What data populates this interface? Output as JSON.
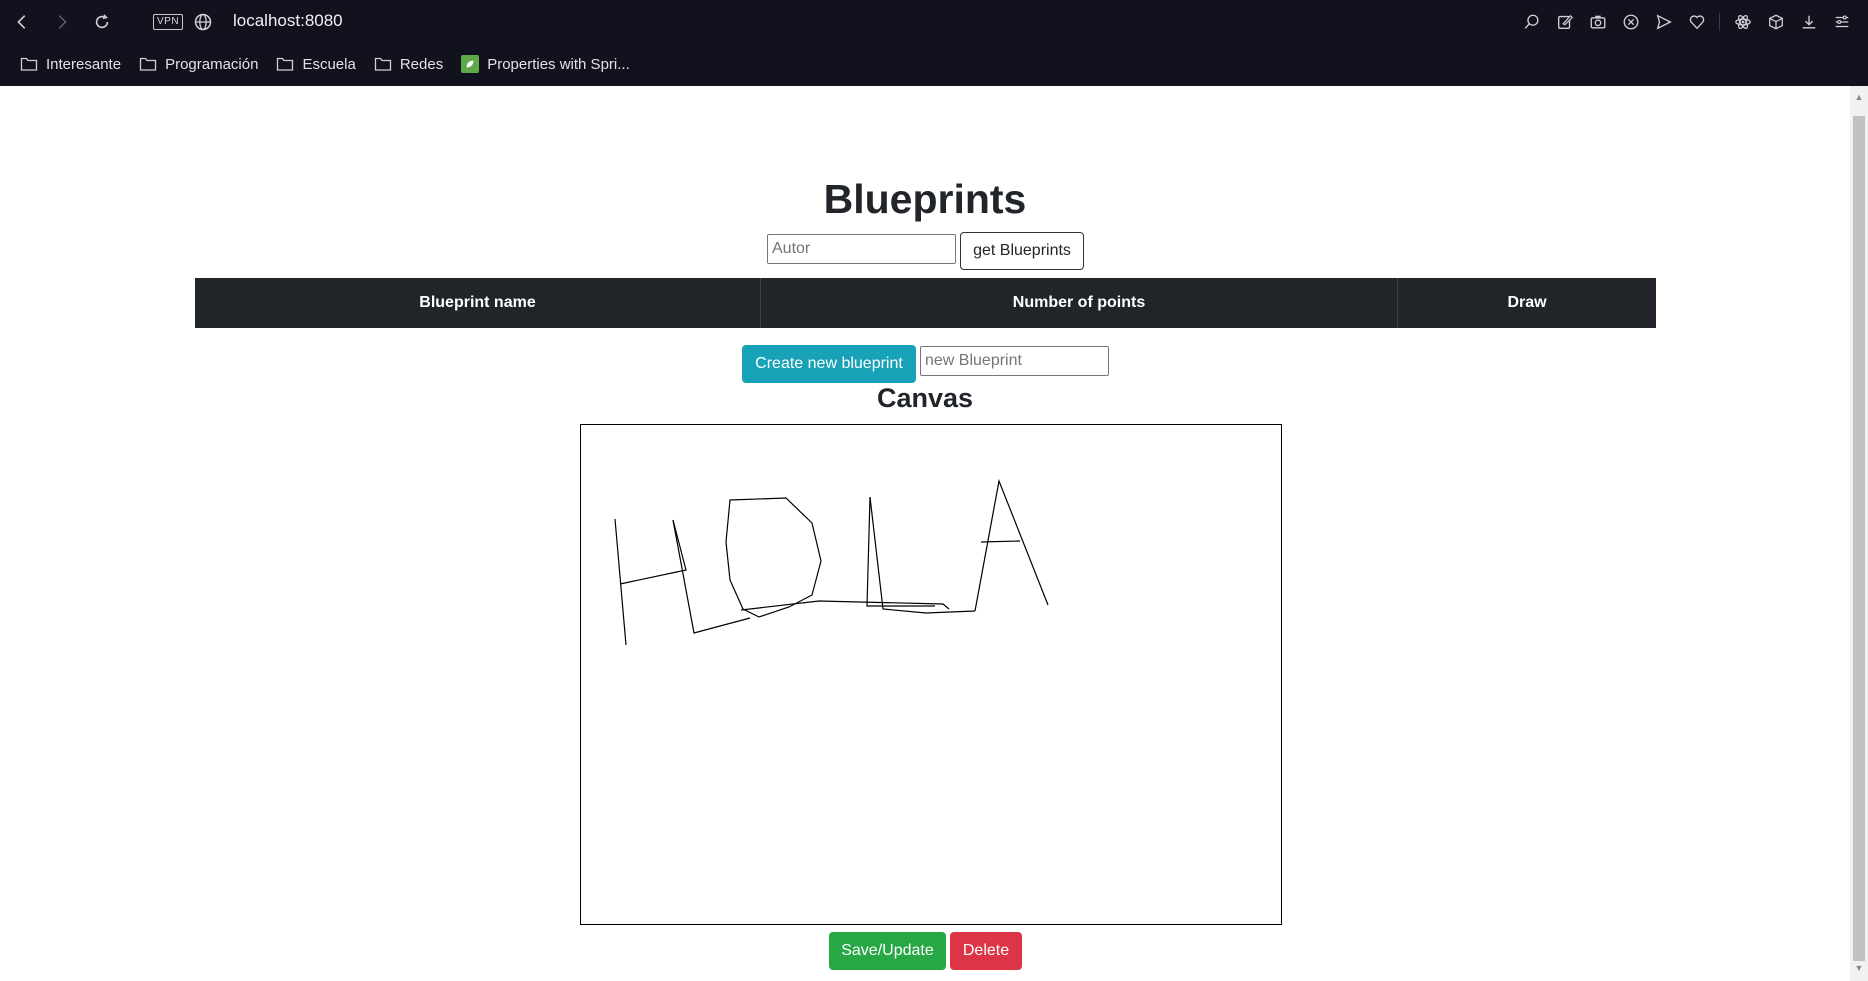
{
  "browser": {
    "vpn_label": "VPN",
    "url": "localhost:8080",
    "bookmarks": [
      {
        "label": "Interesante",
        "icon": "folder-icon"
      },
      {
        "label": "Programación",
        "icon": "folder-icon"
      },
      {
        "label": "Escuela",
        "icon": "folder-icon"
      },
      {
        "label": "Redes",
        "icon": "folder-icon"
      },
      {
        "label": "Properties with Spri...",
        "icon": "spring-leaf-icon"
      }
    ],
    "toolbar_icons": [
      "search-icon",
      "edit-icon",
      "camera-icon",
      "close-circle-icon",
      "send-icon",
      "heart-icon",
      "atom-icon",
      "box-icon",
      "download-icon",
      "menu-icon"
    ]
  },
  "page": {
    "title": "Blueprints",
    "autor_placeholder": "Autor",
    "get_button": "get Blueprints",
    "table_headers": [
      "Blueprint name",
      "Number of points",
      "Draw"
    ],
    "create_button": "Create new blueprint",
    "new_blueprint_placeholder": "new Blueprint",
    "canvas_title": "Canvas",
    "save_button": "Save/Update",
    "delete_button": "Delete"
  },
  "colors": {
    "chrome_bg": "#12121f",
    "table_head_bg": "#212529",
    "create_btn": "#17a2b8",
    "save_btn": "#28a745",
    "delete_btn": "#dc3545"
  },
  "canvas_drawing": {
    "text_drawn": "HOLA",
    "stroke_color": "#000000"
  }
}
